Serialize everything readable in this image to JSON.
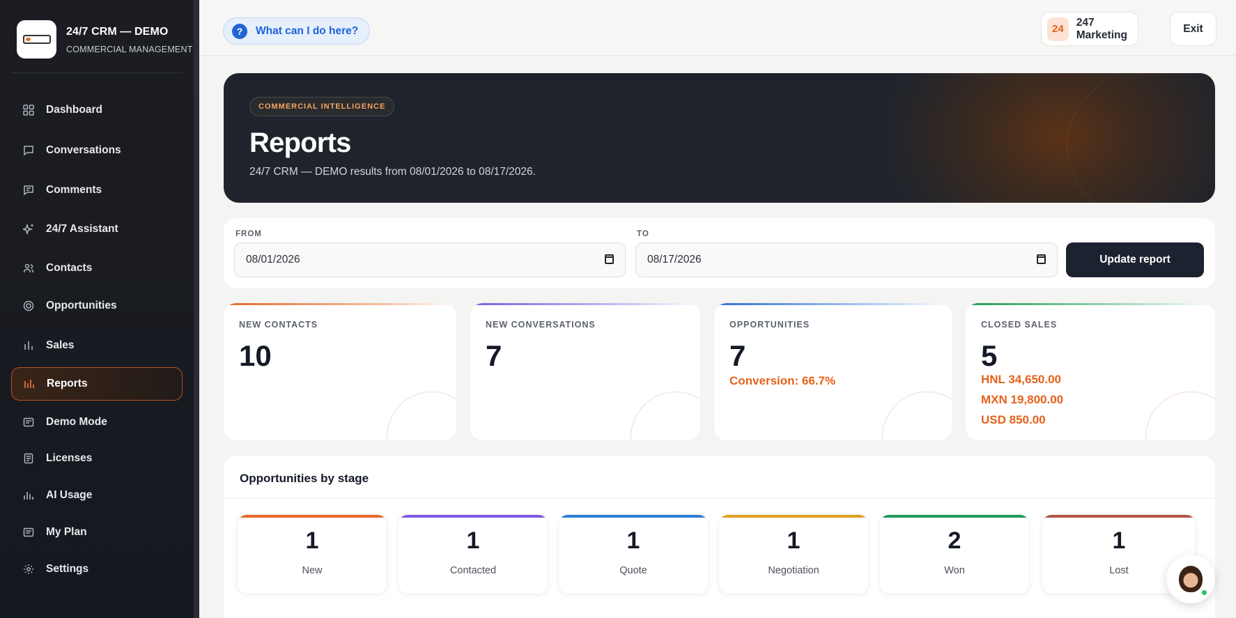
{
  "sidebar": {
    "brand_title": "24/7 CRM — DEMO",
    "brand_subtitle": "COMMERCIAL MANAGEMENT",
    "items": [
      {
        "label": "Dashboard",
        "icon": "grid-icon"
      },
      {
        "label": "Conversations",
        "icon": "chat-bubble-icon"
      },
      {
        "label": "Comments",
        "icon": "comment-lines-icon"
      },
      {
        "label": "24/7 Assistant",
        "icon": "sparkle-icon"
      },
      {
        "label": "Contacts",
        "icon": "users-icon"
      },
      {
        "label": "Opportunities",
        "icon": "target-icon"
      },
      {
        "label": "Sales",
        "icon": "bar-chart-icon"
      },
      {
        "label": "Reports",
        "icon": "report-bars-icon",
        "active": true
      },
      {
        "label": "Demo Mode",
        "icon": "card-icon"
      },
      {
        "label": "Licenses",
        "icon": "document-icon"
      },
      {
        "label": "AI Usage",
        "icon": "usage-bars-icon"
      },
      {
        "label": "My Plan",
        "icon": "plan-icon"
      },
      {
        "label": "Settings",
        "icon": "gear-icon"
      }
    ]
  },
  "topbar": {
    "help_label": "What can I do here?",
    "workspace_badge": "24",
    "workspace_name": "247 Marketing",
    "exit_label": "Exit"
  },
  "hero": {
    "tag": "COMMERCIAL INTELLIGENCE",
    "title": "Reports",
    "subtitle": "24/7 CRM — DEMO results from 08/01/2026 to 08/17/2026."
  },
  "filter": {
    "from_label": "FROM",
    "from_value": "08/01/2026",
    "to_label": "TO",
    "to_value": "08/17/2026",
    "update_label": "Update report"
  },
  "stats": [
    {
      "label": "NEW CONTACTS",
      "value": "10",
      "accent": "#e8682a"
    },
    {
      "label": "NEW CONVERSATIONS",
      "value": "7",
      "accent": "#7c5ce0"
    },
    {
      "label": "OPPORTUNITIES",
      "value": "7",
      "conversion": "Conversion: 66.7%",
      "accent": "#2f6fd6"
    },
    {
      "label": "CLOSED SALES",
      "value": "5",
      "amounts": [
        "HNL 34,650.00",
        "MXN 19,800.00",
        "USD 850.00"
      ],
      "accent": "#1f9a5a"
    }
  ],
  "stages": {
    "title": "Opportunities by stage",
    "items": [
      {
        "count": "1",
        "name": "New",
        "color": "#e8682a"
      },
      {
        "count": "1",
        "name": "Contacted",
        "color": "#7c5ce0"
      },
      {
        "count": "1",
        "name": "Quote",
        "color": "#2f7fd6"
      },
      {
        "count": "1",
        "name": "Negotiation",
        "color": "#e0a020"
      },
      {
        "count": "2",
        "name": "Won",
        "color": "#1f9a5a"
      },
      {
        "count": "1",
        "name": "Lost",
        "color": "#b5564a"
      }
    ]
  }
}
